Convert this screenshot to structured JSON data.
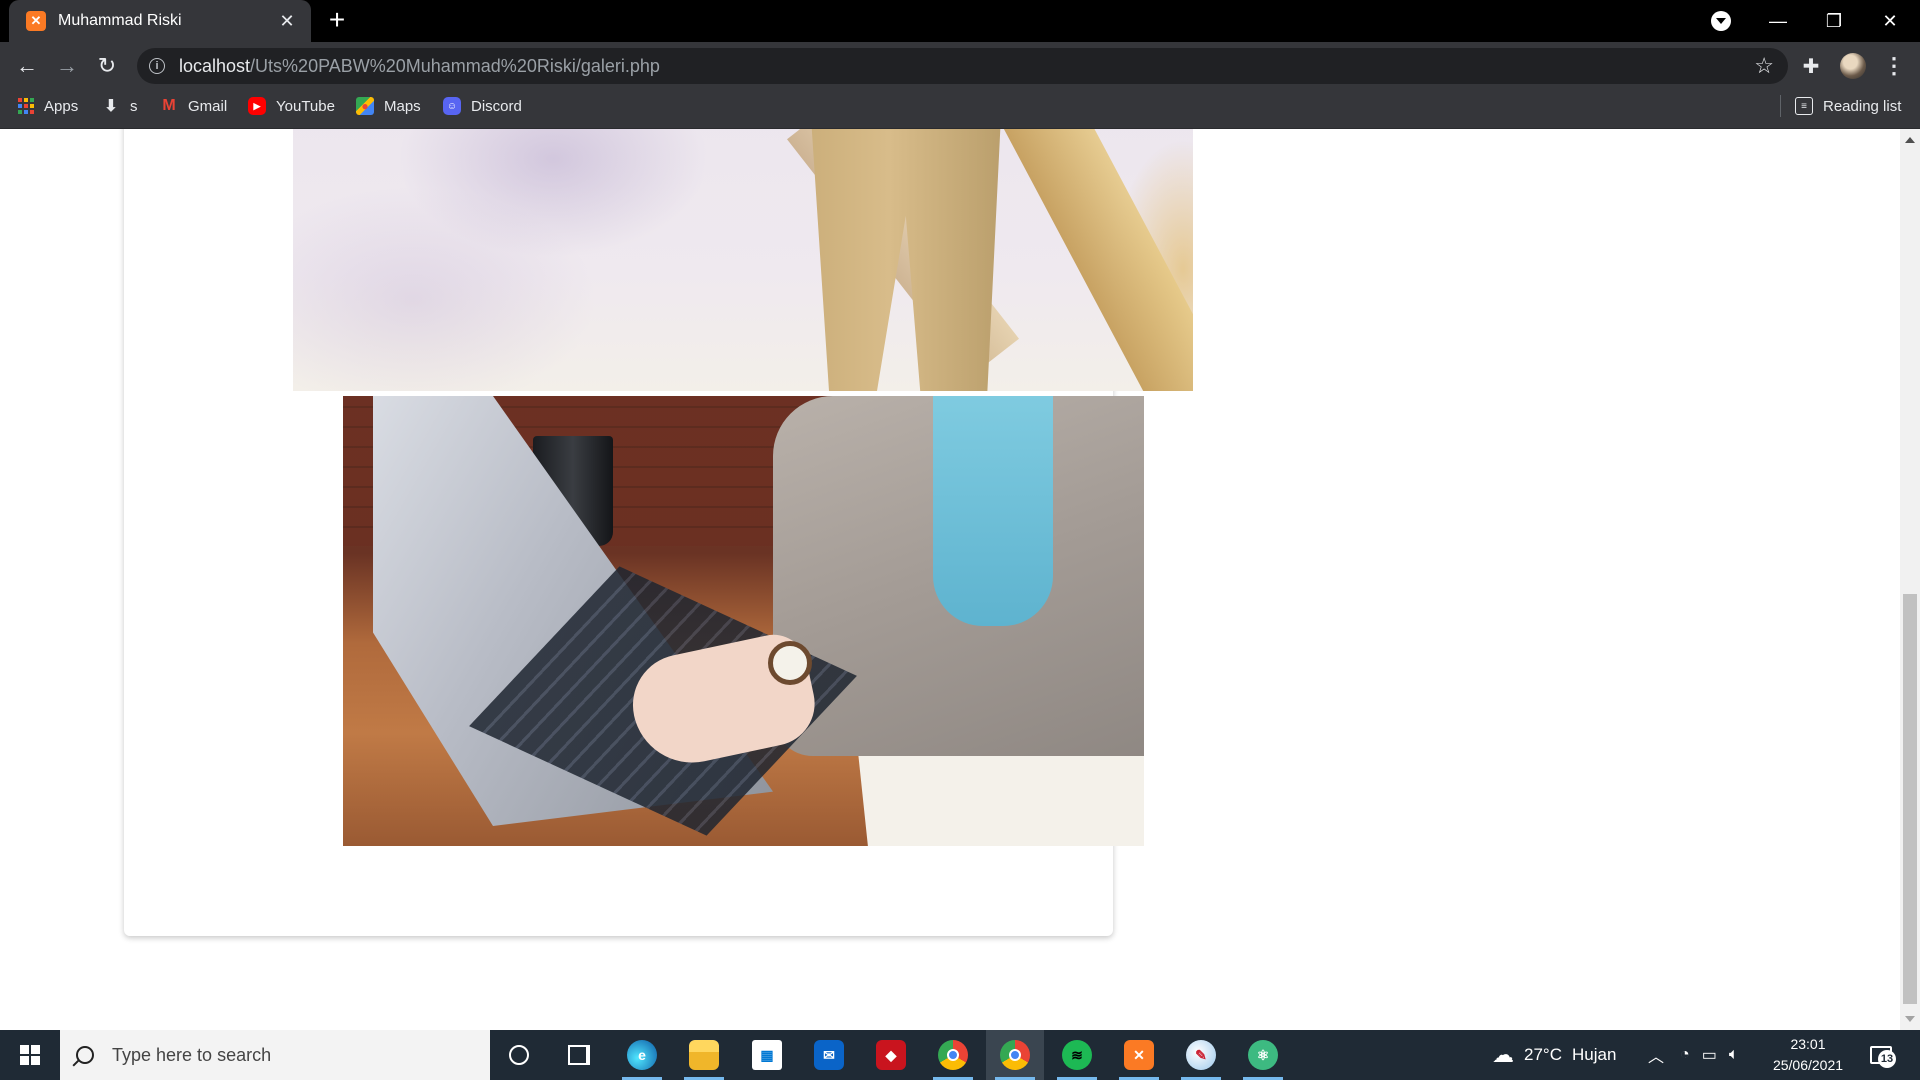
{
  "browser": {
    "tab": {
      "title": "Muhammad Riski",
      "favicon": "xampp-icon"
    },
    "url": {
      "host": "localhost",
      "path": "/Uts%20PABW%20Muhammad%20Riski/galeri.php"
    },
    "bookmarks": [
      {
        "label": "Apps",
        "icon": "apps-grid-icon"
      },
      {
        "label": "s",
        "icon": "download-icon"
      },
      {
        "label": "Gmail",
        "icon": "gmail-icon"
      },
      {
        "label": "YouTube",
        "icon": "youtube-icon"
      },
      {
        "label": "Maps",
        "icon": "maps-icon"
      },
      {
        "label": "Discord",
        "icon": "discord-icon"
      }
    ],
    "reading_list": "Reading list"
  },
  "page": {
    "images": [
      {
        "name": "gallery-photo-man-ladder",
        "icon": "photo"
      },
      {
        "name": "gallery-photo-laptop-typing",
        "icon": "photo"
      }
    ]
  },
  "taskbar": {
    "search_placeholder": "Type here to search",
    "apps": [
      "cortana",
      "task-view",
      "edge",
      "file-explorer",
      "microsoft-store",
      "mail",
      "game",
      "chrome",
      "chrome-profile",
      "spotify",
      "xampp",
      "paint",
      "atom"
    ],
    "weather": {
      "temp": "27°C",
      "condition": "Hujan"
    },
    "time": "23:01",
    "date": "25/06/2021",
    "notifications": "13"
  },
  "colors": {
    "chrome_dark": "#35363a",
    "titlebar": "#000000",
    "omnibox": "#202124",
    "taskbar": "#1f2a35",
    "accent_active": "#76b9ed"
  }
}
